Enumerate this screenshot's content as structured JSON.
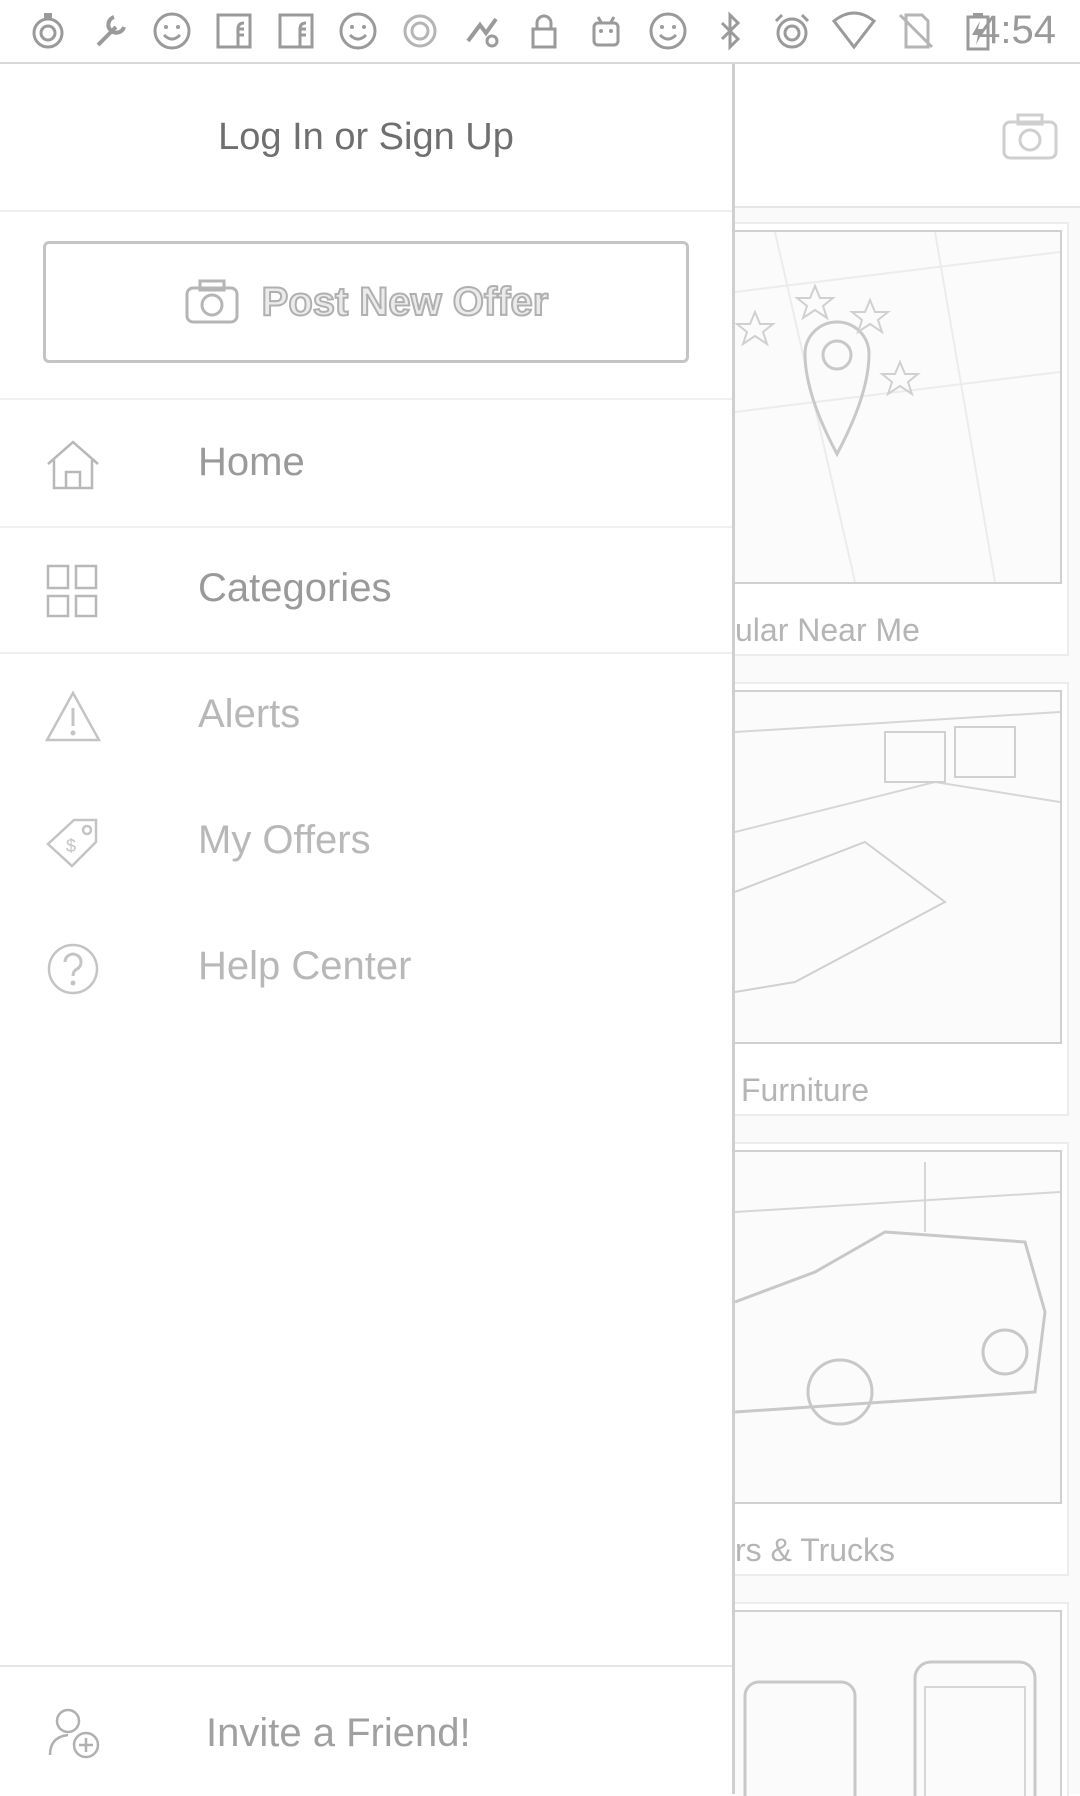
{
  "status_bar": {
    "time": "4:54",
    "icons": [
      "timer-icon",
      "wrench-icon",
      "smiley-icon",
      "facebook-icon",
      "facebook-icon",
      "smiley-icon",
      "circle-app-icon",
      "game-icon",
      "lock-icon",
      "android-icon",
      "smiley-icon",
      "bluetooth-icon",
      "alarm-icon",
      "wifi-icon",
      "no-sim-icon",
      "battery-charging-icon"
    ]
  },
  "drawer": {
    "login_label": "Log In or Sign Up",
    "post_button_label": "Post New Offer",
    "items": [
      {
        "label": "Home",
        "icon": "home-icon"
      },
      {
        "label": "Categories",
        "icon": "grid-icon"
      },
      {
        "label": "Alerts",
        "icon": "alert-icon"
      },
      {
        "label": "My Offers",
        "icon": "tag-icon"
      },
      {
        "label": "Help Center",
        "icon": "help-icon"
      }
    ],
    "invite_label": "Invite a Friend!"
  },
  "background": {
    "cards": [
      {
        "caption": "ular Near Me"
      },
      {
        "caption": "Furniture"
      },
      {
        "caption": "rs & Trucks"
      },
      {
        "caption": ""
      }
    ]
  },
  "colors": {
    "text": "#9a9a9a",
    "border": "#c4c4c4",
    "background": "#ffffff"
  }
}
